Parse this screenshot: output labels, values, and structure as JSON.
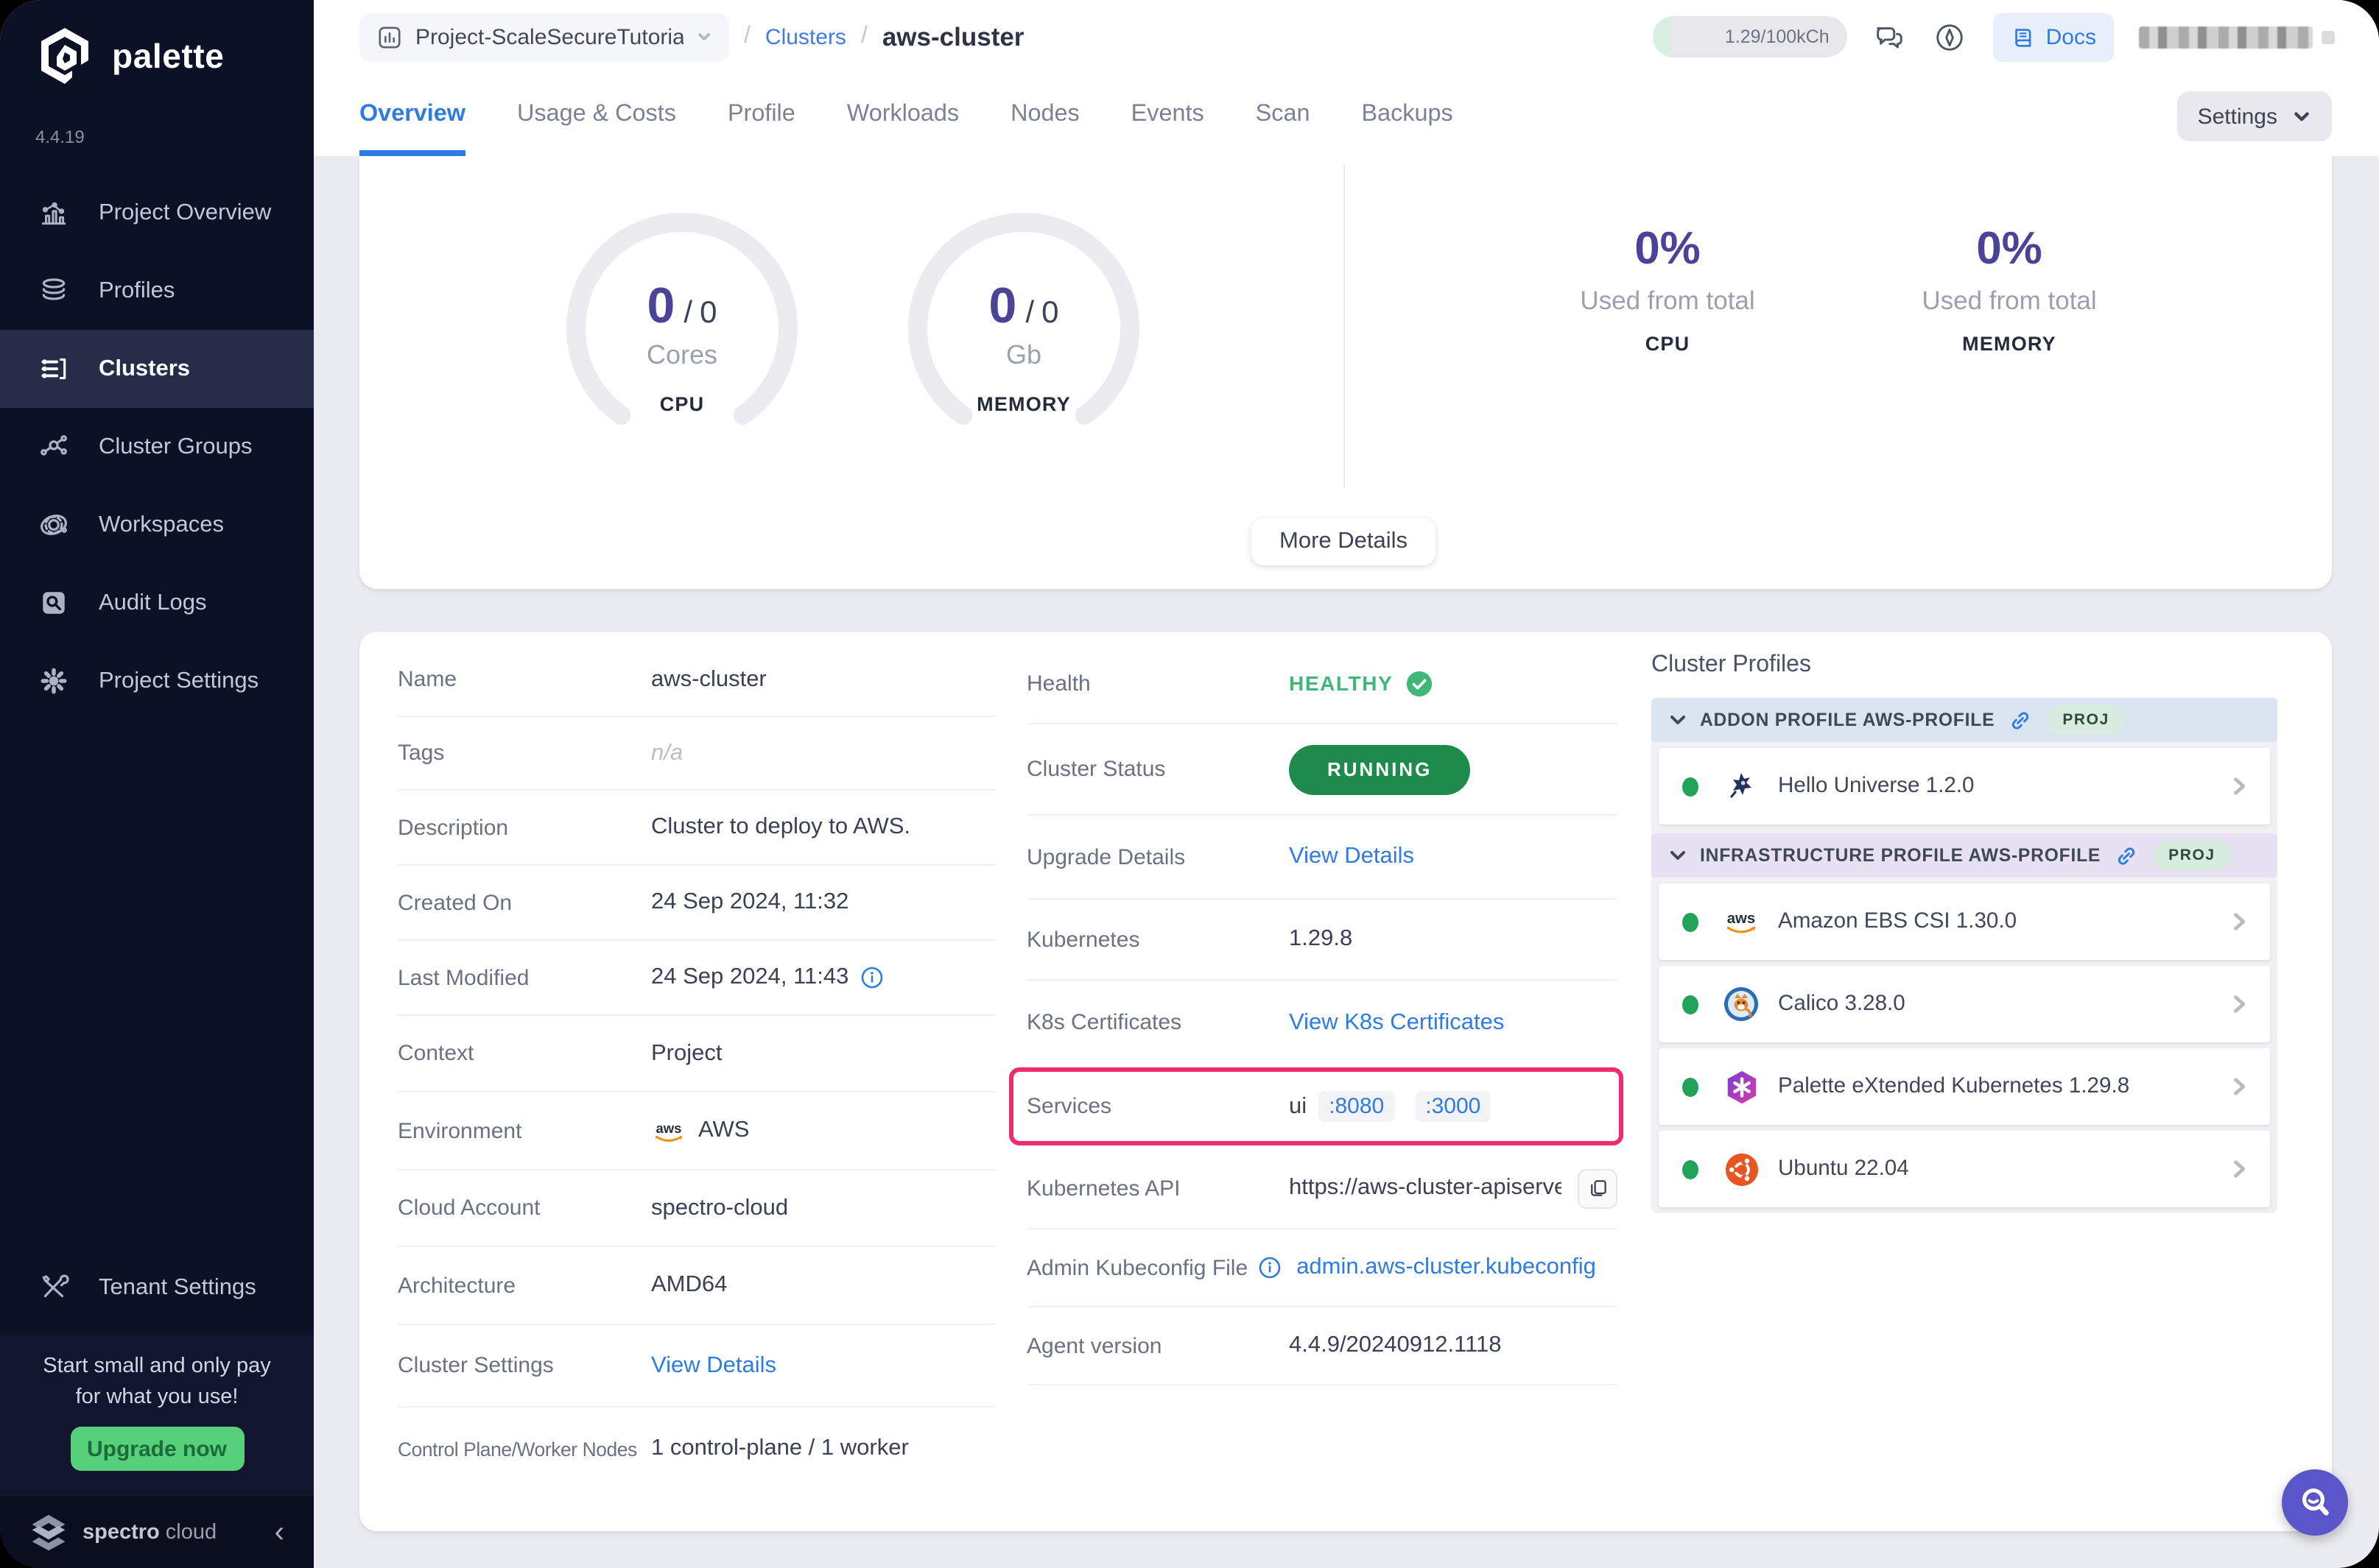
{
  "colors": {
    "accent_blue": "#2e7ce2",
    "purple": "#4a4397",
    "running_green": "#1e8a4c",
    "healthy_green": "#3fb877",
    "highlight_pink": "#ee2b6b",
    "promo_green": "#57d07c",
    "sidebar_bg": "#0d1126"
  },
  "app": {
    "brand": "palette",
    "version": "4.4.19",
    "footer_brand_1": "spectro",
    "footer_brand_2": "cloud"
  },
  "sidebar": {
    "items": [
      {
        "label": "Project Overview",
        "icon": "bar-chart-icon"
      },
      {
        "label": "Profiles",
        "icon": "layers-icon"
      },
      {
        "label": "Clusters",
        "icon": "server-list-icon"
      },
      {
        "label": "Cluster Groups",
        "icon": "network-icon"
      },
      {
        "label": "Workspaces",
        "icon": "orbit-icon"
      },
      {
        "label": "Audit Logs",
        "icon": "audit-search-icon"
      },
      {
        "label": "Project Settings",
        "icon": "gear-icon"
      }
    ],
    "active_item": "Clusters",
    "tenant_settings": {
      "label": "Tenant Settings",
      "icon": "tools-icon"
    },
    "promo": {
      "line1": "Start small and only pay",
      "line2": "for what you use!",
      "button_label": "Upgrade now"
    }
  },
  "header": {
    "project_name": "Project-ScaleSecureTutoria",
    "separator": "/",
    "breadcrumb_section": "Clusters",
    "breadcrumb_current": "aws-cluster",
    "credits": "1.29/100kCh",
    "docs_label": "Docs"
  },
  "tabs": {
    "items": [
      "Overview",
      "Usage & Costs",
      "Profile",
      "Workloads",
      "Nodes",
      "Events",
      "Scan",
      "Backups"
    ],
    "active": "Overview",
    "settings_label": "Settings"
  },
  "summary": {
    "gauges": [
      {
        "used": "0",
        "divider": "/",
        "total": "0",
        "unit": "Cores",
        "label": "CPU"
      },
      {
        "used": "0",
        "divider": "/",
        "total": "0",
        "unit": "Gb",
        "label": "MEMORY"
      }
    ],
    "usage": [
      {
        "percent": "0%",
        "caption": "Used from total",
        "label": "CPU"
      },
      {
        "percent": "0%",
        "caption": "Used from total",
        "label": "MEMORY"
      }
    ],
    "more_details_label": "More Details"
  },
  "details": {
    "rows": [
      {
        "label": "Name",
        "value": "aws-cluster"
      },
      {
        "label": "Tags",
        "value": "n/a"
      },
      {
        "label": "Description",
        "value": "Cluster to deploy to AWS."
      },
      {
        "label": "Created On",
        "value": "24 Sep 2024, 11:32"
      },
      {
        "label": "Last Modified",
        "value": "24 Sep 2024, 11:43"
      },
      {
        "label": "Context",
        "value": "Project"
      },
      {
        "label": "Environment",
        "value": "AWS"
      },
      {
        "label": "Cloud Account",
        "value": "spectro-cloud"
      },
      {
        "label": "Architecture",
        "value": "AMD64"
      },
      {
        "label": "Cluster Settings",
        "value": "View Details"
      },
      {
        "label": "Control Plane/Worker Nodes",
        "value": "1 control-plane / 1 worker"
      }
    ]
  },
  "status": {
    "health": {
      "label": "Health",
      "value": "HEALTHY"
    },
    "cluster_status": {
      "label": "Cluster Status",
      "value": "RUNNING"
    },
    "upgrade": {
      "label": "Upgrade Details",
      "value": "View Details"
    },
    "kubernetes": {
      "label": "Kubernetes",
      "value": "1.29.8"
    },
    "certificates": {
      "label": "K8s Certificates",
      "value": "View K8s Certificates"
    },
    "services": {
      "label": "Services",
      "name": "ui",
      "ports": [
        ":8080",
        ":3000"
      ]
    },
    "api": {
      "label": "Kubernetes API",
      "value": "https://aws-cluster-apiserve…"
    },
    "kubeconfig": {
      "label": "Admin Kubeconfig File",
      "value": "admin.aws-cluster.kubeconfig"
    },
    "agent": {
      "label": "Agent version",
      "value": "4.4.9/20240912.1118"
    }
  },
  "profiles": {
    "title": "Cluster Profiles",
    "groups": [
      {
        "name": "ADDON PROFILE AWS-PROFILE",
        "badge": "PROJ",
        "items": [
          {
            "name": "Hello Universe 1.2.0",
            "icon": "hello-universe-icon",
            "status_color": "#21a35a"
          }
        ]
      },
      {
        "name": "INFRASTRUCTURE PROFILE AWS-PROFILE",
        "badge": "PROJ",
        "items": [
          {
            "name": "Amazon EBS CSI 1.30.0",
            "icon": "aws-icon",
            "status_color": "#21a35a"
          },
          {
            "name": "Calico 3.28.0",
            "icon": "calico-icon",
            "status_color": "#21a35a"
          },
          {
            "name": "Palette eXtended Kubernetes 1.29.8",
            "icon": "pxk-icon",
            "status_color": "#21a35a"
          },
          {
            "name": "Ubuntu 22.04",
            "icon": "ubuntu-icon",
            "status_color": "#21a35a"
          }
        ]
      }
    ]
  }
}
